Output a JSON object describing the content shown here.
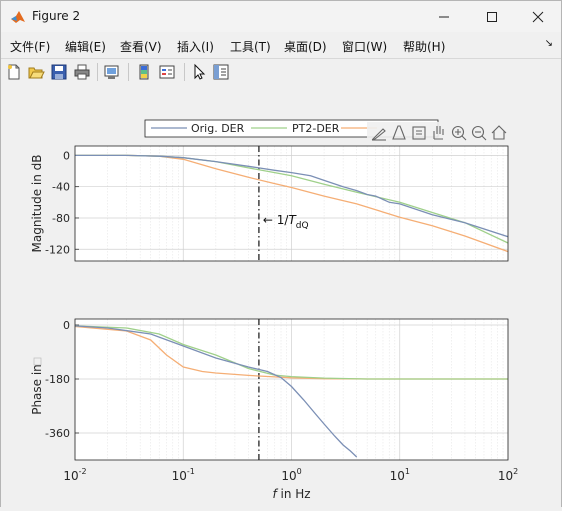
{
  "window": {
    "title": "Figure 2"
  },
  "menu": [
    "文件(F)",
    "编辑(E)",
    "查看(V)",
    "插入(I)",
    "工具(T)",
    "桌面(D)",
    "窗口(W)",
    "帮助(H)"
  ],
  "toolbar_icons": [
    "new-file-icon",
    "open-folder-icon",
    "save-icon",
    "print-icon",
    "link-plot-icon",
    "colorbar-icon",
    "legend-icon",
    "pointer-icon",
    "property-inspector-icon"
  ],
  "axes_toolbar_icons": [
    "brush-icon",
    "data-tips-icon",
    "restore-view-icon",
    "pan-icon",
    "zoom-in-icon",
    "zoom-out-icon",
    "home-icon"
  ],
  "legend": {
    "entries": [
      "Orig. DER",
      "PT2-DER"
    ]
  },
  "annotation": {
    "prefix": "← 1/",
    "var": "T",
    "sub": "dQ"
  },
  "xlabel_var": "f",
  "xlabel_rest": " in Hz",
  "colors": {
    "orig": "#7b8fb5",
    "pt2": "#9fd08a",
    "third": "#f5ae75"
  },
  "chart_data": [
    {
      "type": "line",
      "xscale": "log",
      "xlim": [
        0.01,
        100
      ],
      "ylim": [
        -135,
        12
      ],
      "yticks": [
        "0",
        "-40",
        "-80",
        "-120"
      ],
      "ytick_values": [
        0,
        -40,
        -80,
        -120
      ],
      "ylabel": "Magnitude in dB",
      "vline_x": 0.5,
      "series": [
        {
          "name": "Orig. DER",
          "x": [
            0.01,
            0.03,
            0.06,
            0.1,
            0.2,
            0.4,
            0.7,
            1,
            1.5,
            2,
            3,
            4,
            5,
            6,
            8,
            10,
            20,
            40,
            100
          ],
          "y": [
            0,
            0,
            -1,
            -3,
            -8,
            -14,
            -19,
            -22,
            -26,
            -32,
            -40,
            -45,
            -50,
            -52,
            -60,
            -62,
            -76,
            -86,
            -104
          ]
        },
        {
          "name": "PT2-DER",
          "x": [
            0.01,
            0.03,
            0.06,
            0.1,
            0.2,
            0.4,
            0.7,
            1,
            2,
            4,
            10,
            20,
            40,
            100
          ],
          "y": [
            0,
            0,
            -1,
            -3,
            -8,
            -16,
            -22,
            -26,
            -37,
            -47,
            -60,
            -73,
            -86,
            -112
          ]
        },
        {
          "x": [
            0.01,
            0.03,
            0.06,
            0.1,
            0.2,
            0.4,
            0.7,
            1,
            2,
            4,
            10,
            20,
            40,
            100
          ],
          "y": [
            0,
            0,
            -1,
            -5,
            -17,
            -28,
            -36,
            -41,
            -52,
            -62,
            -79,
            -90,
            -103,
            -123
          ]
        }
      ]
    },
    {
      "type": "line",
      "xscale": "log",
      "xlim": [
        0.01,
        100
      ],
      "ylim": [
        -450,
        20
      ],
      "yticks": [
        "0",
        "-180",
        "-360"
      ],
      "ytick_values": [
        0,
        -180,
        -360
      ],
      "ylabel": "Phase in",
      "xticks": [
        "10",
        "10",
        "10",
        "10",
        "10"
      ],
      "xtick_exp": [
        "-2",
        "-1",
        "0",
        "1",
        "2"
      ],
      "vline_x": 0.5,
      "series": [
        {
          "name": "Orig. DER",
          "x": [
            0.01,
            0.02,
            0.05,
            0.1,
            0.2,
            0.4,
            0.6,
            0.8,
            1,
            1.3,
            1.7,
            2,
            2.5,
            3,
            3.5,
            4
          ],
          "y": [
            -3,
            -10,
            -30,
            -70,
            -110,
            -140,
            -155,
            -175,
            -205,
            -250,
            -300,
            -330,
            -370,
            -400,
            -420,
            -440
          ]
        },
        {
          "name": "PT2-DER",
          "x": [
            0.01,
            0.03,
            0.06,
            0.1,
            0.2,
            0.4,
            0.7,
            1,
            2,
            5,
            10,
            100
          ],
          "y": [
            -3,
            -10,
            -30,
            -65,
            -100,
            -145,
            -167,
            -172,
            -177,
            -180,
            -180,
            -180
          ]
        },
        {
          "x": [
            0.01,
            0.03,
            0.05,
            0.07,
            0.1,
            0.15,
            0.2,
            0.4,
            0.7,
            1,
            2,
            5,
            10,
            100
          ],
          "y": [
            -5,
            -20,
            -50,
            -100,
            -140,
            -155,
            -160,
            -168,
            -173,
            -176,
            -179,
            -180,
            -180,
            -180
          ]
        }
      ]
    }
  ]
}
